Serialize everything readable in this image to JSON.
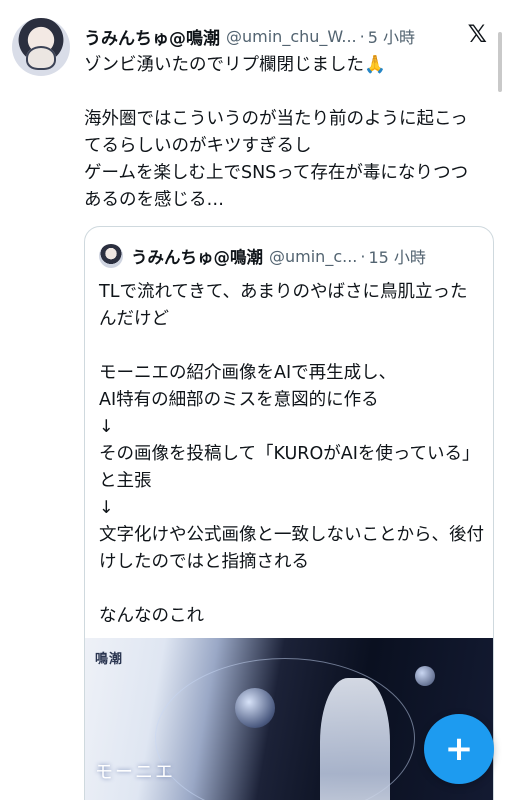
{
  "tweet": {
    "display_name": "うみんちゅ@鳴潮",
    "handle": "@umin_chu_W...",
    "separator": "·",
    "time": "5 小時",
    "text": "ゾンビ湧いたのでリプ欄閉じました🙏\n\n海外圏ではこういうのが当たり前のように起こってるらしいのがキツすぎるし\nゲームを楽しむ上でSNSって存在が毒になりつつあるのを感じる…"
  },
  "quote": {
    "display_name": "うみんちゅ@鳴潮",
    "handle": "@umin_c...",
    "separator": "·",
    "time": "15 小時",
    "text": "TLで流れてきて、あまりのやばさに鳥肌立ったんだけど\n\nモーニエの紹介画像をAIで再生成し、\nAI特有の細部のミスを意図的に作る\n↓\nその画像を投稿して「KUROがAIを使っている」と主張\n↓\n文字化けや公式画像と一致しないことから、後付けしたのではと指摘される\n\nなんなのこれ",
    "image": {
      "brand": "鳴潮",
      "title": "モーニエ"
    }
  },
  "icons": {
    "x_logo": "𝕏",
    "compose": "+"
  },
  "colors": {
    "accent": "#1d9bf0",
    "secondary_text": "#536471",
    "border": "#cfd9de"
  }
}
